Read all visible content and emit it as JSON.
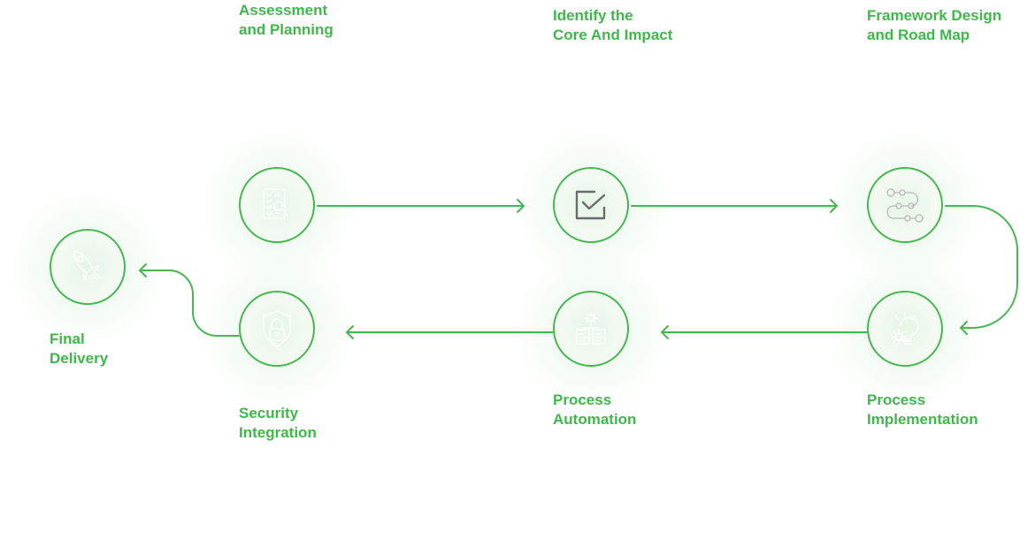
{
  "accent_color": "#45b94f",
  "steps": [
    {
      "id": "assessment",
      "label": "Assessment\nand Planning",
      "icon": "checklist-magnifier-icon"
    },
    {
      "id": "identify",
      "label": "Identify the\nCore And Impact",
      "icon": "checkbox-checked-icon"
    },
    {
      "id": "framework",
      "label": "Framework Design\nand Road Map",
      "icon": "roadmap-path-icon"
    },
    {
      "id": "implementation",
      "label": "Process\nImplementation",
      "icon": "gear-lightbulb-icon"
    },
    {
      "id": "automation",
      "label": "Process\nAutomation",
      "icon": "gear-documents-icon"
    },
    {
      "id": "security",
      "label": "Security\nIntegration",
      "icon": "shield-lock-icon"
    },
    {
      "id": "delivery",
      "label": "Final\nDelivery",
      "icon": "rocket-icon"
    }
  ]
}
